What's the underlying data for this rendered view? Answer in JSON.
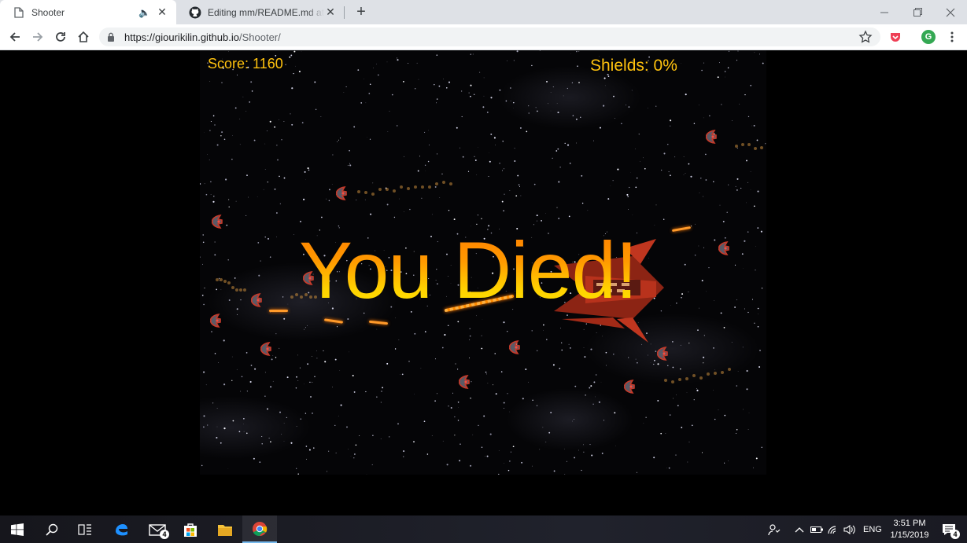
{
  "tabs": [
    {
      "title": "Shooter",
      "active": true,
      "favicon": "page-icon",
      "audio": true
    },
    {
      "title": "Editing mm/README.md at master",
      "active": false,
      "favicon": "github-icon"
    }
  ],
  "address_bar": {
    "url_host": "https://giourikilin.github.io",
    "url_path": "/Shooter/"
  },
  "game": {
    "score_label": "Score: 1160",
    "shields_label": "Shields: 0%",
    "death_message": "You Died!"
  },
  "taskbar": {
    "mail_badge": "4",
    "language": "ENG",
    "time": "3:51 PM",
    "date": "1/15/2019",
    "notifications_badge": "4"
  },
  "colors": {
    "hud": "#ffc20e",
    "death_top": "#ff7a00",
    "death_bottom": "#ffe800"
  }
}
